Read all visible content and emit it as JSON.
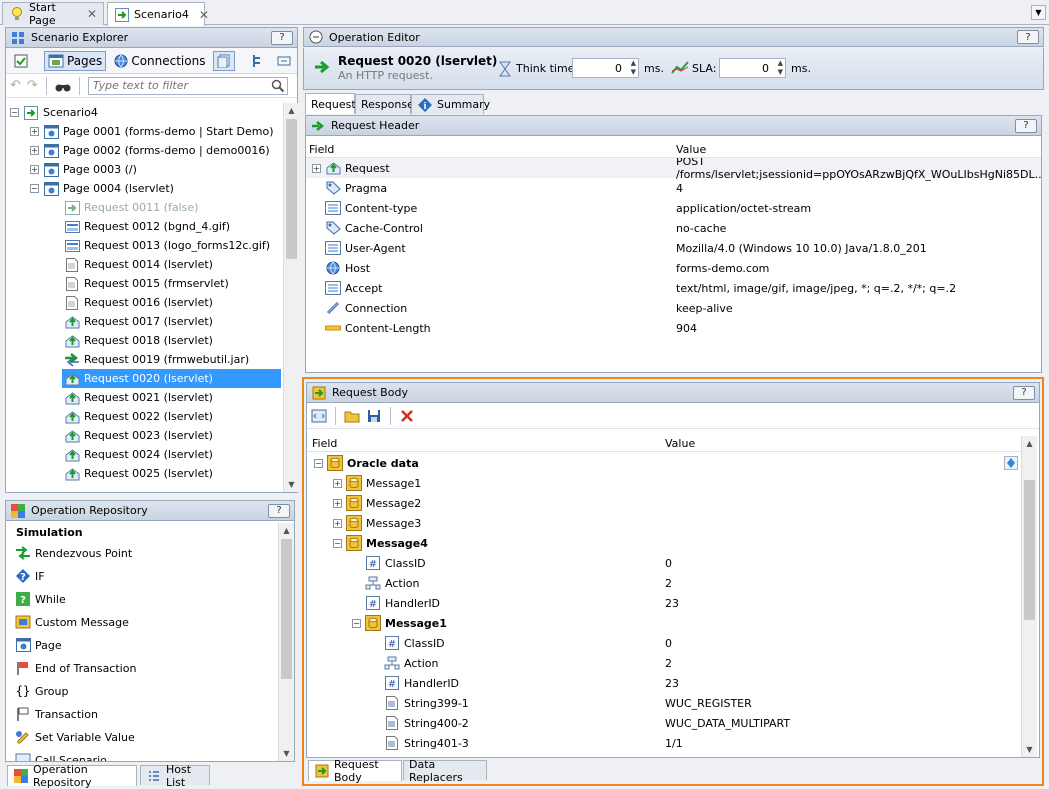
{
  "doc_tabs": [
    {
      "label": "Start Page"
    },
    {
      "label": "Scenario4"
    }
  ],
  "explorer": {
    "title": "Scenario Explorer",
    "help": "?",
    "pages_label": "Pages",
    "connections_label": "Connections",
    "filter_placeholder": "Type text to filter",
    "tree": [
      {
        "label": "Scenario4",
        "level": 0,
        "exp": "−",
        "icon": "scenario"
      },
      {
        "label": "Page 0001 (forms-demo | Start Demo)",
        "level": 1,
        "exp": "+",
        "icon": "page"
      },
      {
        "label": "Page 0002 (forms-demo | demo0016)",
        "level": 1,
        "exp": "+",
        "icon": "page"
      },
      {
        "label": "Page 0003 (/)",
        "level": 1,
        "exp": "+",
        "icon": "page"
      },
      {
        "label": "Page 0004 (lservlet)",
        "level": 1,
        "exp": "−",
        "icon": "page"
      },
      {
        "label": "Request 0011 (false)",
        "level": 2,
        "icon": "req-gray",
        "dim": true
      },
      {
        "label": "Request 0012 (bgnd_4.gif)",
        "level": 2,
        "icon": "img"
      },
      {
        "label": "Request 0013 (logo_forms12c.gif)",
        "level": 2,
        "icon": "img"
      },
      {
        "label": "Request 0014 (lservlet)",
        "level": 2,
        "icon": "doc"
      },
      {
        "label": "Request 0015 (frmservlet)",
        "level": 2,
        "icon": "doc"
      },
      {
        "label": "Request 0016 (lservlet)",
        "level": 2,
        "icon": "doc"
      },
      {
        "label": "Request 0017 (lservlet)",
        "level": 2,
        "icon": "post"
      },
      {
        "label": "Request 0018 (lservlet)",
        "level": 2,
        "icon": "post"
      },
      {
        "label": "Request 0019 (frmwebutil.jar)",
        "level": 2,
        "icon": "arrow"
      },
      {
        "label": "Request 0020 (lservlet)",
        "level": 2,
        "icon": "post",
        "selected": true
      },
      {
        "label": "Request 0021 (lservlet)",
        "level": 2,
        "icon": "post"
      },
      {
        "label": "Request 0022 (lservlet)",
        "level": 2,
        "icon": "post"
      },
      {
        "label": "Request 0023 (lservlet)",
        "level": 2,
        "icon": "post"
      },
      {
        "label": "Request 0024 (lservlet)",
        "level": 2,
        "icon": "post"
      },
      {
        "label": "Request 0025 (lservlet)",
        "level": 2,
        "icon": "post"
      }
    ]
  },
  "repo": {
    "title": "Operation Repository",
    "help": "?",
    "section": "Simulation",
    "items": [
      {
        "label": "Rendezvous Point",
        "icon": "rendezvous"
      },
      {
        "label": "IF",
        "icon": "if"
      },
      {
        "label": "While",
        "icon": "while"
      },
      {
        "label": "Custom Message",
        "icon": "message"
      },
      {
        "label": "Page",
        "icon": "page"
      },
      {
        "label": "End of Transaction",
        "icon": "flag"
      },
      {
        "label": "Group",
        "icon": "group"
      },
      {
        "label": "Transaction",
        "icon": "transaction"
      },
      {
        "label": "Set Variable Value",
        "icon": "variable"
      },
      {
        "label": "Call Scenario",
        "icon": "call"
      }
    ],
    "bottom_tabs": [
      {
        "label": "Operation Repository"
      },
      {
        "label": "Host List"
      }
    ]
  },
  "editor": {
    "title": "Operation Editor",
    "help": "?",
    "request_title": "Request 0020 (lservlet)",
    "request_subtitle": "An HTTP request.",
    "think_label": "Think time:",
    "think_value": "0",
    "think_unit": "ms.",
    "sla_label": "SLA:",
    "sla_value": "0",
    "sla_unit": "ms.",
    "tabs": [
      {
        "label": "Request"
      },
      {
        "label": "Response"
      },
      {
        "label": "Summary"
      }
    ]
  },
  "header_panel": {
    "title": "Request Header",
    "help": "?",
    "col_field": "Field",
    "col_value": "Value",
    "rows": [
      {
        "field": "Request",
        "value": "POST /forms/lservlet;jsessionid=ppOYOsARzwBjQfX_WOuLIbsHgNi85DL...",
        "icon": "post",
        "exp": "+"
      },
      {
        "field": "Pragma",
        "value": "4",
        "icon": "tag"
      },
      {
        "field": "Content-type",
        "value": "application/octet-stream",
        "icon": "list"
      },
      {
        "field": "Cache-Control",
        "value": "no-cache",
        "icon": "tag"
      },
      {
        "field": "User-Agent",
        "value": "Mozilla/4.0 (Windows 10 10.0) Java/1.8.0_201",
        "icon": "list"
      },
      {
        "field": "Host",
        "value": "forms-demo.com",
        "icon": "globe"
      },
      {
        "field": "Accept",
        "value": "text/html, image/gif, image/jpeg, *; q=.2, */*; q=.2",
        "icon": "list"
      },
      {
        "field": "Connection",
        "value": "keep-alive",
        "icon": "link"
      },
      {
        "field": "Content-Length",
        "value": "904",
        "icon": "ruler"
      }
    ]
  },
  "body_panel": {
    "title": "Request Body",
    "help": "?",
    "col_field": "Field",
    "col_value": "Value",
    "rows": [
      {
        "field": "Oracle data",
        "value": "",
        "level": 0,
        "exp": "−",
        "icon": "db",
        "bold": true
      },
      {
        "field": "Message1",
        "value": "",
        "level": 1,
        "exp": "+",
        "icon": "db"
      },
      {
        "field": "Message2",
        "value": "",
        "level": 1,
        "exp": "+",
        "icon": "db"
      },
      {
        "field": "Message3",
        "value": "",
        "level": 1,
        "exp": "+",
        "icon": "db"
      },
      {
        "field": "Message4",
        "value": "",
        "level": 1,
        "exp": "−",
        "icon": "db",
        "bold": true
      },
      {
        "field": "ClassID",
        "value": "0",
        "level": 2,
        "icon": "hash"
      },
      {
        "field": "Action",
        "value": "2",
        "level": 2,
        "icon": "action"
      },
      {
        "field": "HandlerID",
        "value": "23",
        "level": 2,
        "icon": "hash"
      },
      {
        "field": "Message1",
        "value": "",
        "level": 2,
        "exp": "−",
        "icon": "db",
        "bold": true
      },
      {
        "field": "ClassID",
        "value": "0",
        "level": 3,
        "icon": "hash"
      },
      {
        "field": "Action",
        "value": "2",
        "level": 3,
        "icon": "action"
      },
      {
        "field": "HandlerID",
        "value": "23",
        "level": 3,
        "icon": "hash"
      },
      {
        "field": "String399-1",
        "value": "WUC_REGISTER",
        "level": 3,
        "icon": "str"
      },
      {
        "field": "String400-2",
        "value": "WUC_DATA_MULTIPART",
        "level": 3,
        "icon": "str"
      },
      {
        "field": "String401-3",
        "value": "1/1",
        "level": 3,
        "icon": "str"
      }
    ],
    "bottom_tabs": [
      {
        "label": "Request Body"
      },
      {
        "label": "Data Replacers"
      }
    ]
  },
  "colors": {
    "accent": "#3399ff",
    "highlight_border": "#f0851d",
    "panel_title": "#c9d3e1"
  }
}
